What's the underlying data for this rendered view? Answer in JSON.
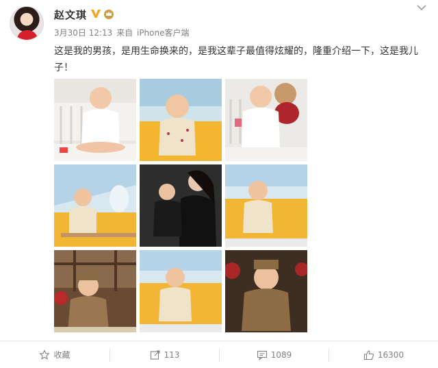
{
  "user": {
    "name": "赵文琪",
    "time": "3月30日 12:13",
    "via_prefix": "来自",
    "via_source": "iPhone客户端"
  },
  "post": {
    "text": "这是我的男孩，是用生命换来的，是我这辈子最值得炫耀的，隆重介绍一下，这是我儿子！"
  },
  "colors": {
    "accent": "#eb7350",
    "vip": "#f5a623",
    "meta_text": "#808080"
  },
  "actions": {
    "favorite_label": "收藏",
    "repost_count": "113",
    "comment_count": "1089",
    "like_count": "16300"
  }
}
